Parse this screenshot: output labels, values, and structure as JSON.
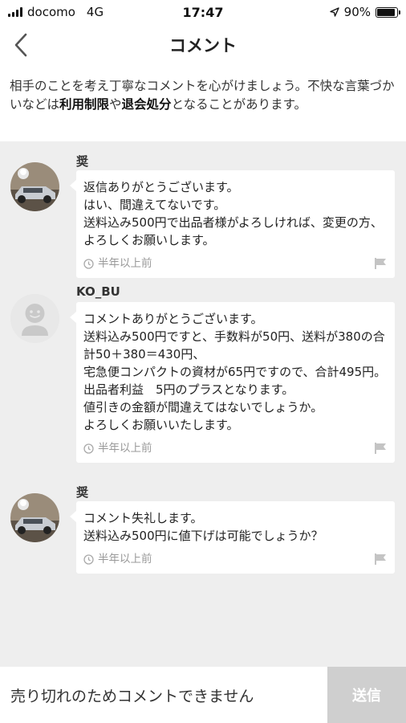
{
  "status_bar": {
    "carrier": "docomo",
    "network": "4G",
    "time": "17:47",
    "battery_percent": "90%",
    "battery_level": 0.9
  },
  "nav": {
    "title": "コメント"
  },
  "notice": {
    "part1": "相手のことを考え丁寧なコメントを心がけましょう。不快な言葉づかいなどは",
    "bold1": "利用制限",
    "part2": "や",
    "bold2": "退会処分",
    "part3": "となることがあります。"
  },
  "comments": [
    {
      "author": "奨",
      "text": "返信ありがとうございます。\nはい、間違えてないです。\n送料込み500円で出品者様がよろしければ、変更の方、よろしくお願いします。",
      "time": "半年以上前",
      "avatar_icon": "car-photo-avatar"
    },
    {
      "author": "KO_BU",
      "text": "コメントありがとうございます。\n送料込み500円ですと、手数料が50円、送料が380の合計50＋380＝430円、\n宅急便コンパクトの資材が65円ですので、合計495円。\n出品者利益　5円のプラスとなります。\n値引きの金額が間違えてはないでしょうか。\nよろしくお願いいたします。",
      "time": "半年以上前",
      "avatar_icon": "default-user-avatar"
    },
    {
      "author": "奨",
      "text": "コメント失礼します。\n送料込み500円に値下げは可能でしょうか？",
      "time": "半年以上前",
      "avatar_icon": "car-photo-avatar"
    }
  ],
  "footer": {
    "placeholder": "売り切れのためコメントできません",
    "send_label": "送信"
  },
  "colors": {
    "background": "#eeeeee",
    "send_disabled": "#cfcfcf",
    "meta_gray": "#999999"
  }
}
